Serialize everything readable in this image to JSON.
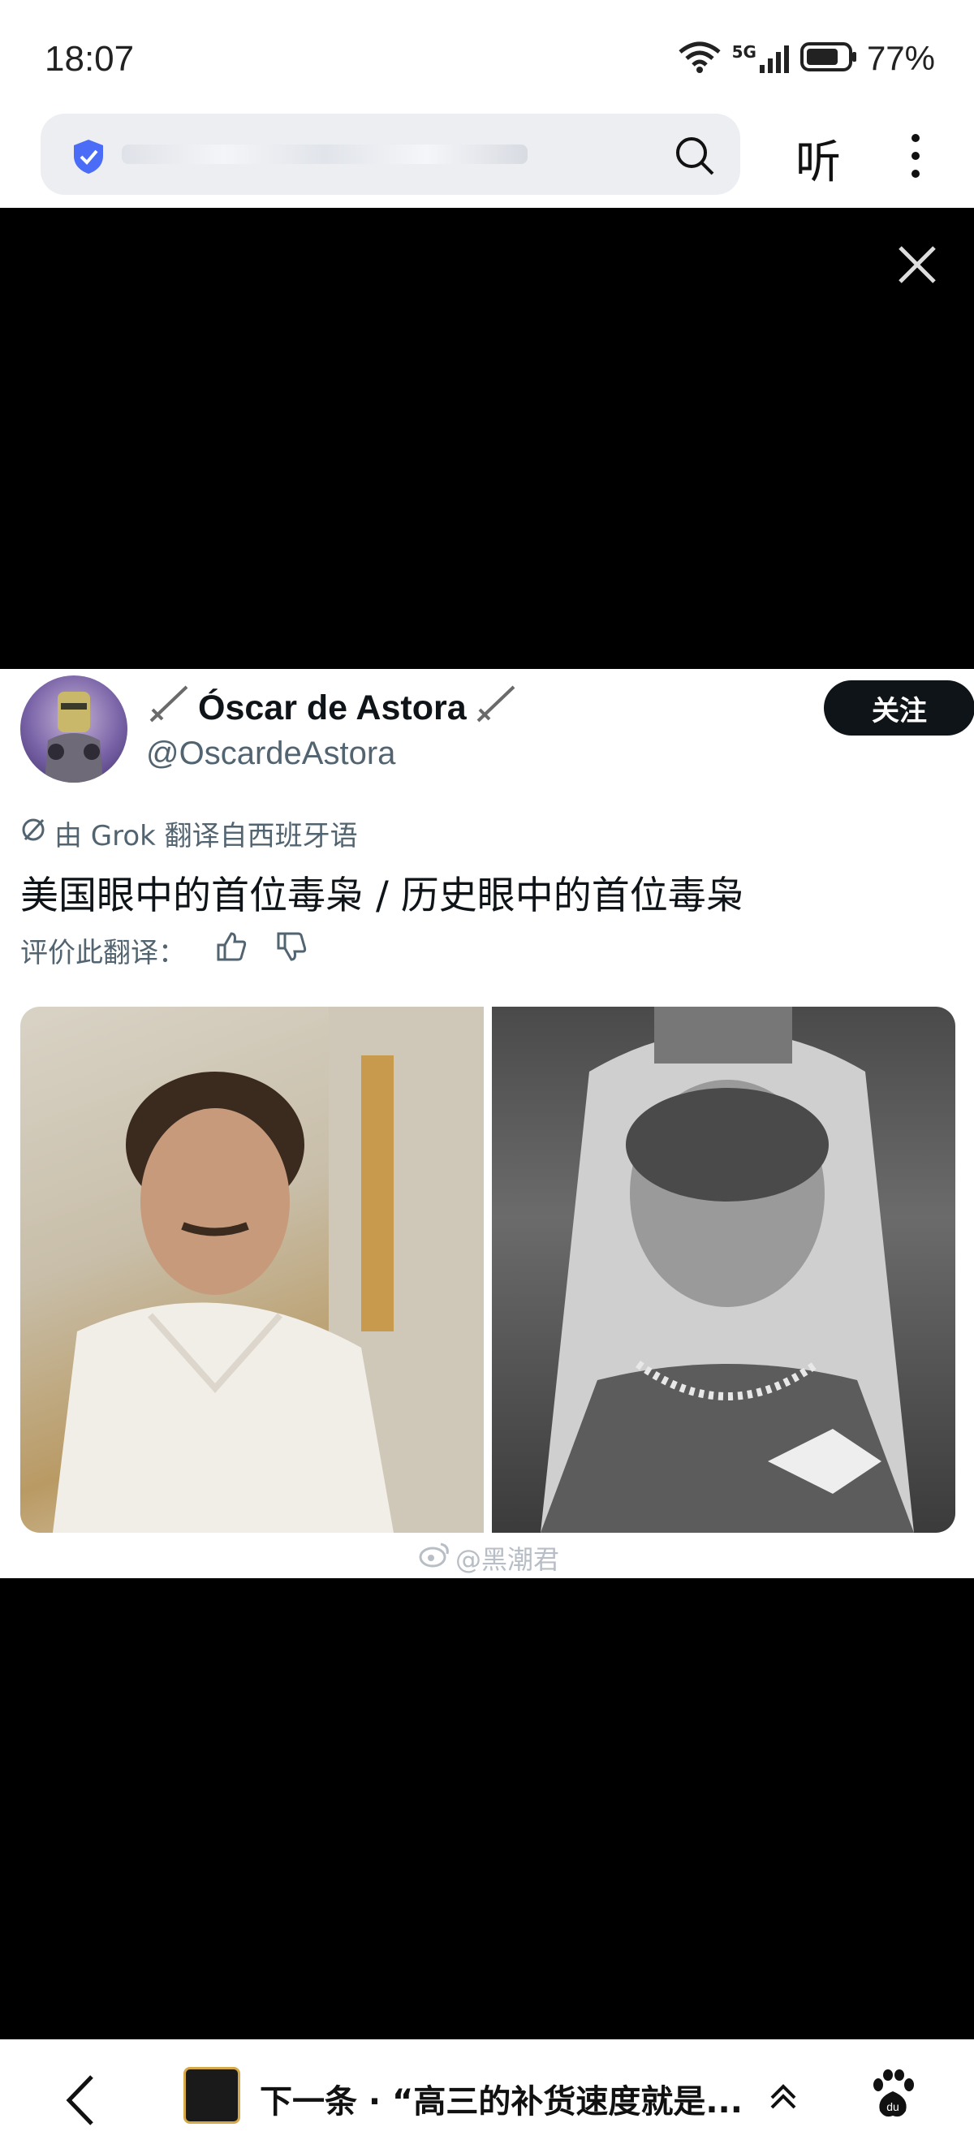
{
  "status_bar": {
    "time": "18:07",
    "network": "5G",
    "battery": "77%"
  },
  "browser": {
    "listen_label": "听"
  },
  "tweet": {
    "display_name": "Óscar de Astora",
    "handle": "@OscardeAstora",
    "follow_label": "关注",
    "translated_by": "由 Grok 翻译自西班牙语",
    "text": "美国眼中的首位毒枭 / 历史眼中的首位毒枭",
    "rate_label": "评价此翻译："
  },
  "watermark": "@黑潮君",
  "bottom_nav": {
    "next_label": "下一条 · “高三的补货速度就是..."
  },
  "colors": {
    "follow_bg": "#0f1419",
    "shield": "#4a6cf7",
    "muted": "#536471"
  }
}
